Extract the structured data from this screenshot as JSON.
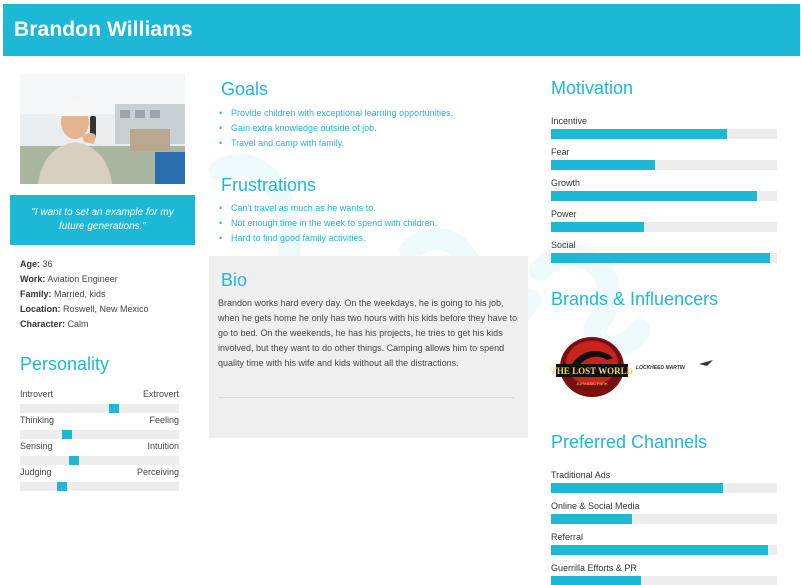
{
  "header": {
    "name": "Brandon Williams"
  },
  "quote": "\"I want to set an example for my future generations.\"",
  "info": [
    {
      "label": "Age:",
      "value": " 36"
    },
    {
      "label": "Work:",
      "value": " Aviation Engineer"
    },
    {
      "label": "Family:",
      "value": " Married, kids"
    },
    {
      "label": "Location:",
      "value": "  Roswell, New Mexico"
    },
    {
      "label": "Character:",
      "value": "  Calm"
    }
  ],
  "personality": {
    "title": "Personality",
    "scales": [
      {
        "left": "Introvert",
        "right": "Extrovert",
        "level": 0.6
      },
      {
        "left": "Thinking",
        "right": "Feeling",
        "level": 0.28
      },
      {
        "left": "Sensing",
        "right": "Intuition",
        "level": 0.33
      },
      {
        "left": "Judging",
        "right": "Perceiving",
        "level": 0.25
      }
    ]
  },
  "goals": {
    "title": "Goals",
    "items": [
      "Provide children with exceptional learning opportunities.",
      "Gain extra knowledge outside of job.",
      "Travel and camp with family."
    ]
  },
  "frustrations": {
    "title": "Frustrations",
    "items": [
      "Can't travel as much as he wants to.",
      "Not enough time in the week to spend with children.",
      "Hard to find good family activities."
    ]
  },
  "bio": {
    "title": "Bio",
    "text": "Brandon works hard every day. On the weekdays, he is going to his job, when he gets home he only has two hours with his kids before they have to go to bed. On the weekends, he has his projects, he tries to get his kids involved, but they want to do other things. Camping allows him to spend quality time with his wife and kids without all the distractions."
  },
  "motivation": {
    "title": "Motivation",
    "items": [
      {
        "label": "Incentive",
        "value": 0.78
      },
      {
        "label": "Fear",
        "value": 0.46
      },
      {
        "label": "Growth",
        "value": 0.91
      },
      {
        "label": "Power",
        "value": 0.41
      },
      {
        "label": "Social",
        "value": 0.97
      }
    ]
  },
  "brands": {
    "title": "Brands & Influencers",
    "logo1_line1": "THE LOST WORLD",
    "logo1_line2": "JURASSIC PARK",
    "logo2": "LOCKHEED MARTIN"
  },
  "channels": {
    "title": "Preferred Channels",
    "items": [
      {
        "label": "Traditional Ads",
        "value": 0.76
      },
      {
        "label": "Online & Social Media",
        "value": 0.36
      },
      {
        "label": "Referral",
        "value": 0.96
      },
      {
        "label": "Guerrilla Efforts & PR",
        "value": 0.4
      }
    ]
  },
  "colors": {
    "accent": "#1db8d6",
    "track": "#ececec",
    "bio_bg": "#efefef"
  }
}
